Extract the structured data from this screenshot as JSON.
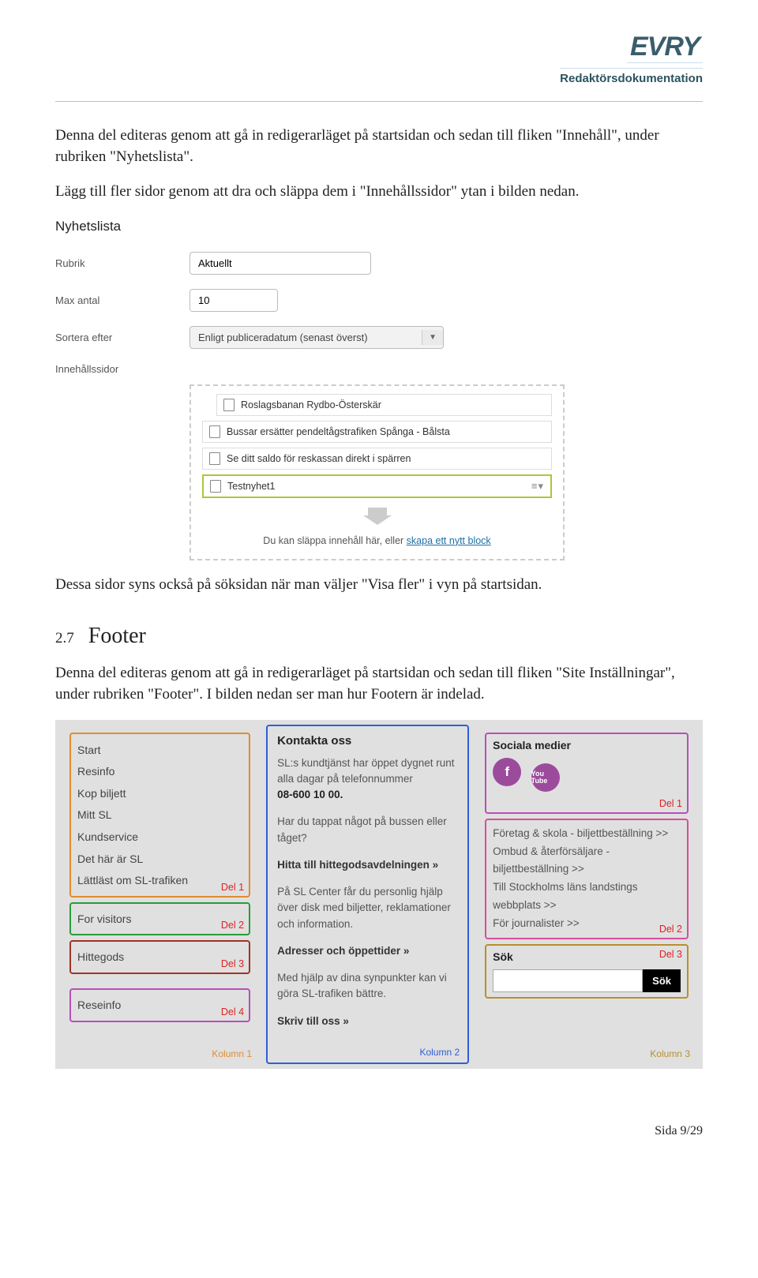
{
  "header": {
    "brand": "EVRY",
    "doc_type": "Redaktörsdokumentation"
  },
  "paragraphs": {
    "p1": "Denna del editeras genom att gå in redigerarläget på startsidan och sedan till fliken \"Innehåll\", under rubriken \"Nyhetslista\".",
    "p2": "Lägg till fler sidor genom att dra och släppa dem i \"Innehållssidor\" ytan i bilden nedan.",
    "p3": "Dessa sidor syns också på söksidan när man väljer \"Visa fler\" i vyn på startsidan.",
    "p4": "Denna del editeras genom att gå in redigerarläget på startsidan och sedan till fliken \"Site Inställningar\", under rubriken \"Footer\". I bilden nedan ser man hur Footern är indelad."
  },
  "section": {
    "num": "2.7",
    "title": "Footer"
  },
  "form": {
    "title": "Nyhetslista",
    "labels": {
      "rubrik": "Rubrik",
      "max_antal": "Max antal",
      "sortera": "Sortera efter",
      "innehall": "Innehållssidor"
    },
    "values": {
      "rubrik": "Aktuellt",
      "max_antal": "10",
      "sortera": "Enligt publiceradatum (senast överst)"
    },
    "pages": [
      "Roslagsbanan Rydbo-Österskär",
      "Bussar ersätter pendeltågstrafiken Spånga - Bålsta",
      "Se ditt saldo för reskassan direkt i spärren",
      "Testnyhet1"
    ],
    "drop_text": "Du kan släppa innehåll här, eller ",
    "drop_link": "skapa ett nytt block"
  },
  "footer_shot": {
    "col1": {
      "del1": [
        "Start",
        "Resinfo",
        "Kop biljett",
        "Mitt SL",
        "Kundservice",
        "Det här är SL",
        "Lättläst om SL-trafiken"
      ],
      "del2": "For visitors",
      "del3": "Hittegods",
      "del4": "Reseinfo",
      "del1_label": "Del 1",
      "del2_label": "Del 2",
      "del3_label": "Del 3",
      "del4_label": "Del 4",
      "col_label": "Kolumn 1"
    },
    "col2": {
      "heading": "Kontakta oss",
      "p1a": "SL:s kundtjänst har öppet dygnet runt alla dagar på telefonnummer",
      "p1b": "08-600 10 00.",
      "p2": "Har du tappat något på bussen eller tåget?",
      "link1": "Hitta till hittegodsavdelningen »",
      "p3": "På SL Center får du personlig hjälp över disk med biljetter, reklamationer och information.",
      "link2": "Adresser och öppettider »",
      "p4": "Med hjälp av dina synpunkter kan vi göra SL-trafiken bättre.",
      "link3": "Skriv till oss »",
      "col_label": "Kolumn 2"
    },
    "col3": {
      "social_heading": "Sociala medier",
      "fb": "f",
      "yt": "You Tube",
      "del1_label": "Del 1",
      "links": [
        "Företag & skola - biljettbeställning >>",
        "Ombud & återförsäljare - biljettbeställning >>",
        "Till Stockholms läns landstings webbplats >>",
        "För journalister >>"
      ],
      "del2_label": "Del 2",
      "search_heading": "Sök",
      "search_btn": "Sök",
      "del3_label": "Del 3",
      "col_label": "Kolumn 3"
    }
  },
  "page_footer": "Sida 9/29"
}
